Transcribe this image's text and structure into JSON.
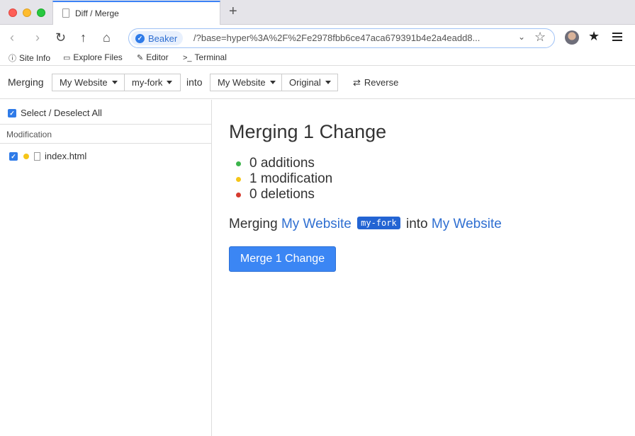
{
  "tab": {
    "title": "Diff / Merge",
    "new_tab_icon": "plus-icon"
  },
  "nav": {
    "back_icon": "chevron-left-icon",
    "forward_icon": "chevron-right-icon",
    "reload_icon": "reload-icon",
    "up_icon": "up-arrow-icon",
    "home_icon": "home-icon",
    "site_pill": "Beaker",
    "url": "/?base=hyper%3A%2F%2Fe2978fbb6ce47aca679391b4e2a4eadd8..."
  },
  "subbar": {
    "site_info": "Site Info",
    "explore_files": "Explore Files",
    "editor": "Editor",
    "terminal": "Terminal"
  },
  "mergebar": {
    "merging_label": "Merging",
    "source_site": "My Website",
    "source_version": "my-fork",
    "into_label": "into",
    "target_site": "My Website",
    "target_version": "Original",
    "reverse_label": "Reverse"
  },
  "sidebar": {
    "select_all": "Select / Deselect All",
    "section": "Modification",
    "files": [
      {
        "name": "index.html",
        "status": "modified"
      }
    ]
  },
  "main": {
    "heading": "Merging 1 Change",
    "stats": [
      {
        "text": "0 additions",
        "color": "#3cb44b"
      },
      {
        "text": "1 modification",
        "color": "#f5c518"
      },
      {
        "text": "0 deletions",
        "color": "#d63b2f"
      }
    ],
    "summary_prefix": "Merging",
    "summary_source": "My Website",
    "summary_badge": "my-fork",
    "summary_into": "into",
    "summary_target": "My Website",
    "merge_button": "Merge 1 Change"
  },
  "colors": {
    "accent": "#3b86f4",
    "link": "#2f6fd1",
    "badge": "#2364d3"
  }
}
